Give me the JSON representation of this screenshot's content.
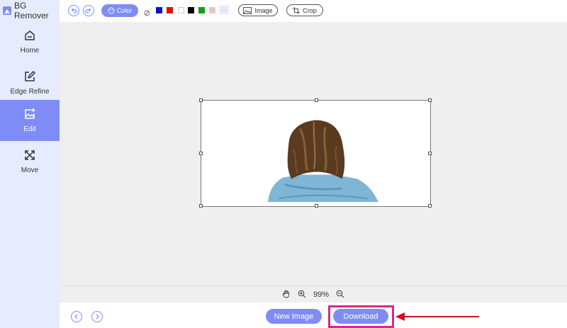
{
  "app": {
    "title": "BG Remover"
  },
  "sidebar": {
    "items": [
      {
        "label": "Home",
        "icon": "home-icon"
      },
      {
        "label": "Edge Refine",
        "icon": "edit-square-icon"
      },
      {
        "label": "Edit",
        "icon": "image-add-icon",
        "active": true
      },
      {
        "label": "Move",
        "icon": "move-arrows-icon"
      }
    ]
  },
  "toolbar": {
    "color_label": "Color",
    "image_label": "Image",
    "crop_label": "Crop",
    "swatches": [
      "transparent",
      "#1010d0",
      "#e01010",
      "#ffffff",
      "#000000",
      "#10a010",
      "#f4c0c8"
    ],
    "more_label": "···"
  },
  "zoom": {
    "level": "99%"
  },
  "actions": {
    "new_image_label": "New Image",
    "download_label": "Download"
  },
  "colors": {
    "accent": "#7f8cf5",
    "sidebar_bg": "#e6ecfd",
    "highlight": "#e0248a",
    "arrow": "#d0102a"
  }
}
